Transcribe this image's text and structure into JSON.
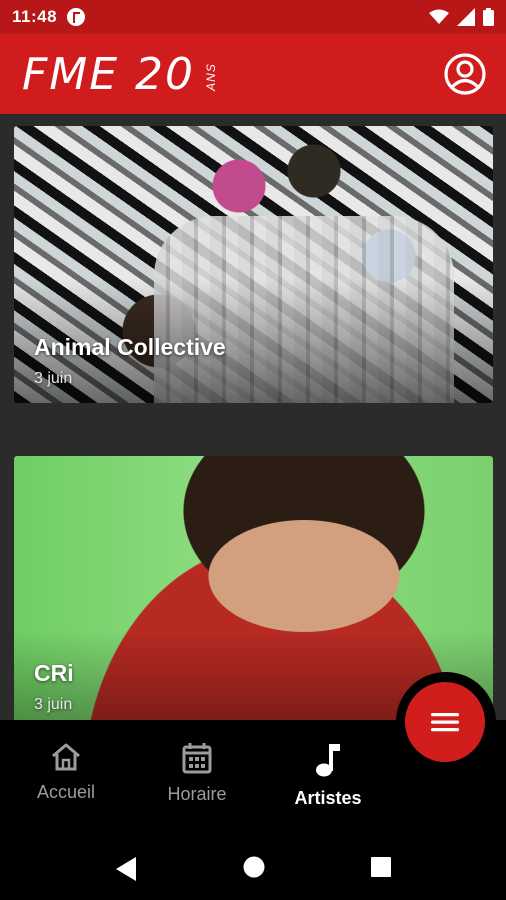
{
  "status_bar": {
    "time": "11:48",
    "icons": [
      "app-notification-icon",
      "wifi-icon",
      "signal-icon",
      "battery-icon"
    ]
  },
  "app_bar": {
    "logo_text": "FME 20",
    "logo_subtext": "ANS",
    "profile_icon": "account-circle-icon",
    "background_color": "#d01c1c"
  },
  "artists": [
    {
      "name": "Animal Collective",
      "date": "3 juin"
    },
    {
      "name": "CRi",
      "date": "3 juin"
    }
  ],
  "fab": {
    "icon": "menu-icon",
    "color": "#d21d1d"
  },
  "bottom_nav": {
    "items": [
      {
        "label": "Accueil",
        "icon": "home-icon",
        "active": false
      },
      {
        "label": "Horaire",
        "icon": "calendar-icon",
        "active": false
      },
      {
        "label": "Artistes",
        "icon": "music-note-icon",
        "active": true
      }
    ]
  },
  "system_nav": [
    "back-icon",
    "home-circle-icon",
    "recents-icon"
  ]
}
